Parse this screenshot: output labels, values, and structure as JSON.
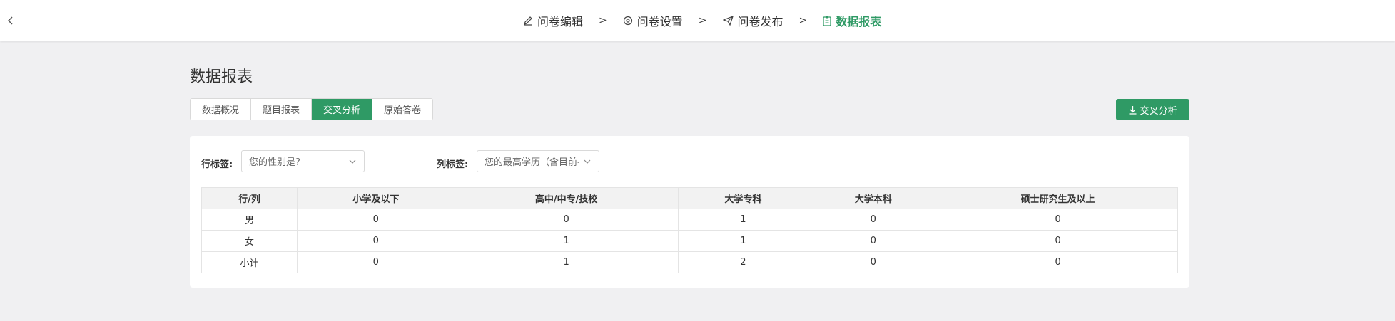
{
  "header": {
    "steps": [
      {
        "label": "问卷编辑"
      },
      {
        "label": "问卷设置"
      },
      {
        "label": "问卷发布"
      },
      {
        "label": "数据报表"
      }
    ],
    "separator": ">"
  },
  "page": {
    "title": "数据报表",
    "tabs": [
      "数据概况",
      "题目报表",
      "交叉分析",
      "原始答卷"
    ],
    "active_tab": "交叉分析",
    "export_label": "交叉分析"
  },
  "filters": {
    "row_label": "行标签:",
    "row_value": "您的性别是?",
    "col_label": "列标签:",
    "col_value": "您的最高学历（含目前在读"
  },
  "table": {
    "headers": [
      "行/列",
      "小学及以下",
      "高中/中专/技校",
      "大学专科",
      "大学本科",
      "硕士研究生及以上"
    ],
    "rows": [
      [
        "男",
        "0",
        "0",
        "1",
        "0",
        "0"
      ],
      [
        "女",
        "0",
        "1",
        "1",
        "0",
        "0"
      ],
      [
        "小计",
        "0",
        "1",
        "2",
        "0",
        "0"
      ]
    ]
  },
  "colors": {
    "accent": "#2f9a65",
    "background": "#f0f0f2"
  }
}
